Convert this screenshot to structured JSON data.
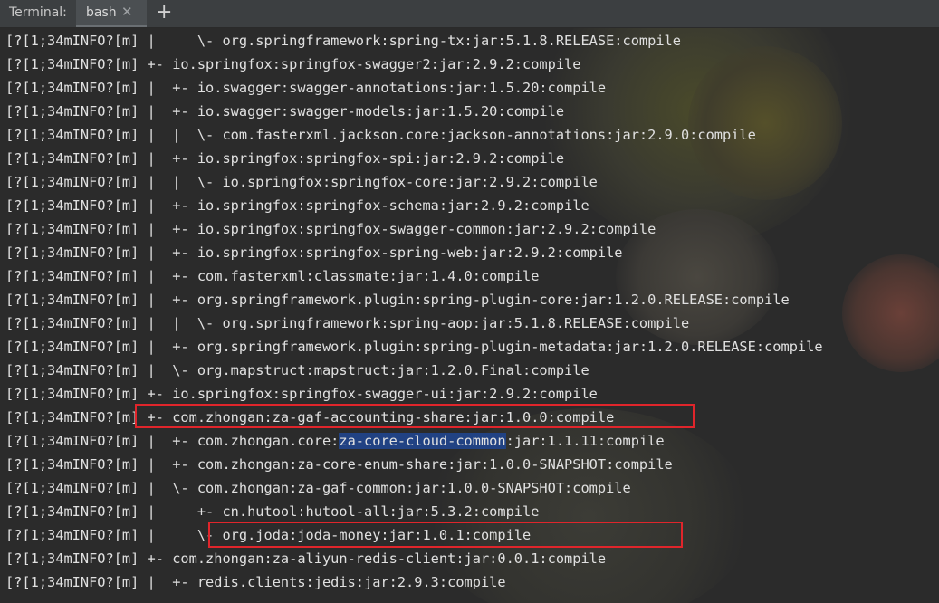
{
  "tabbar": {
    "label": "Terminal:",
    "tab_label": "bash",
    "close_glyph": "✕",
    "add_glyph": "+"
  },
  "terminal": {
    "lines": [
      {
        "text": "[?[1;34mINFO?[m] |     \\- org.springframework:spring-tx:jar:5.1.8.RELEASE:compile"
      },
      {
        "text": "[?[1;34mINFO?[m] +- io.springfox:springfox-swagger2:jar:2.9.2:compile"
      },
      {
        "text": "[?[1;34mINFO?[m] |  +- io.swagger:swagger-annotations:jar:1.5.20:compile"
      },
      {
        "text": "[?[1;34mINFO?[m] |  +- io.swagger:swagger-models:jar:1.5.20:compile"
      },
      {
        "text": "[?[1;34mINFO?[m] |  |  \\- com.fasterxml.jackson.core:jackson-annotations:jar:2.9.0:compile"
      },
      {
        "text": "[?[1;34mINFO?[m] |  +- io.springfox:springfox-spi:jar:2.9.2:compile"
      },
      {
        "text": "[?[1;34mINFO?[m] |  |  \\- io.springfox:springfox-core:jar:2.9.2:compile"
      },
      {
        "text": "[?[1;34mINFO?[m] |  +- io.springfox:springfox-schema:jar:2.9.2:compile"
      },
      {
        "text": "[?[1;34mINFO?[m] |  +- io.springfox:springfox-swagger-common:jar:2.9.2:compile"
      },
      {
        "text": "[?[1;34mINFO?[m] |  +- io.springfox:springfox-spring-web:jar:2.9.2:compile"
      },
      {
        "text": "[?[1;34mINFO?[m] |  +- com.fasterxml:classmate:jar:1.4.0:compile"
      },
      {
        "text": "[?[1;34mINFO?[m] |  +- org.springframework.plugin:spring-plugin-core:jar:1.2.0.RELEASE:compile"
      },
      {
        "text": "[?[1;34mINFO?[m] |  |  \\- org.springframework:spring-aop:jar:5.1.8.RELEASE:compile"
      },
      {
        "text": "[?[1;34mINFO?[m] |  +- org.springframework.plugin:spring-plugin-metadata:jar:1.2.0.RELEASE:compile"
      },
      {
        "text": "[?[1;34mINFO?[m] |  \\- org.mapstruct:mapstruct:jar:1.2.0.Final:compile"
      },
      {
        "text": "[?[1;34mINFO?[m] +- io.springfox:springfox-swagger-ui:jar:2.9.2:compile"
      },
      {
        "text": "[?[1;34mINFO?[m] +- com.zhongan:za-gaf-accounting-share:jar:1.0.0:compile"
      },
      {
        "pre": "[?[1;34mINFO?[m] |  +- com.zhongan.core:",
        "selected": "za-core-cloud-common",
        "post": ":jar:1.1.11:compile"
      },
      {
        "text": "[?[1;34mINFO?[m] |  +- com.zhongan:za-core-enum-share:jar:1.0.0-SNAPSHOT:compile"
      },
      {
        "text": "[?[1;34mINFO?[m] |  \\- com.zhongan:za-gaf-common:jar:1.0.0-SNAPSHOT:compile"
      },
      {
        "text": "[?[1;34mINFO?[m] |     +- cn.hutool:hutool-all:jar:5.3.2:compile"
      },
      {
        "text": "[?[1;34mINFO?[m] |     \\- org.joda:joda-money:jar:1.0.1:compile"
      },
      {
        "text": "[?[1;34mINFO?[m] +- com.zhongan:za-aliyun-redis-client:jar:0.0.1:compile"
      },
      {
        "text": "[?[1;34mINFO?[m] |  +- redis.clients:jedis:jar:2.9.3:compile"
      }
    ]
  },
  "colors": {
    "terminal_bg": "#2b2b2b",
    "text": "#e0e0e0",
    "selection": "#214283",
    "highlight_box": "#e0252b"
  }
}
